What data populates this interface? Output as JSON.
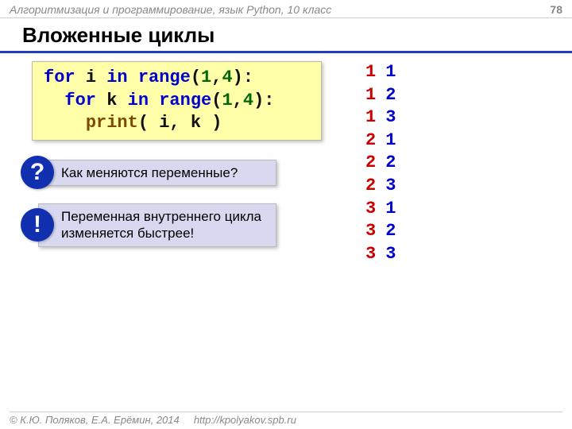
{
  "header": {
    "course": "Алгоритмизация и программирование, язык Python, 10 класс",
    "page": "78"
  },
  "title": "Вложенные циклы",
  "code": {
    "line1": {
      "for": "for",
      "var": "i",
      "in": "in",
      "range": "range",
      "open": "(",
      "a": "1",
      "comma": ",",
      "b": "4",
      "close": "):"
    },
    "line2": {
      "indent": "  ",
      "for": "for",
      "var": "k",
      "in": "in",
      "range": "range",
      "open": "(",
      "a": "1",
      "comma": ",",
      "b": "4",
      "close": "):"
    },
    "line3": {
      "indent": "    ",
      "print": "print",
      "args": "( i, k )"
    }
  },
  "callouts": {
    "q_badge": "?",
    "q_text": "Как меняются переменные?",
    "e_badge": "!",
    "e_text": "Переменная внутреннего цикла изменяется быстрее!"
  },
  "output": [
    {
      "i": "1",
      "k": "1"
    },
    {
      "i": "1",
      "k": "2"
    },
    {
      "i": "1",
      "k": "3"
    },
    {
      "i": "2",
      "k": "1"
    },
    {
      "i": "2",
      "k": "2"
    },
    {
      "i": "2",
      "k": "3"
    },
    {
      "i": "3",
      "k": "1"
    },
    {
      "i": "3",
      "k": "2"
    },
    {
      "i": "3",
      "k": "3"
    }
  ],
  "footer": {
    "copyright": "© К.Ю. Поляков, Е.А. Ерёмин, 2014",
    "url": "http://kpolyakov.spb.ru"
  }
}
